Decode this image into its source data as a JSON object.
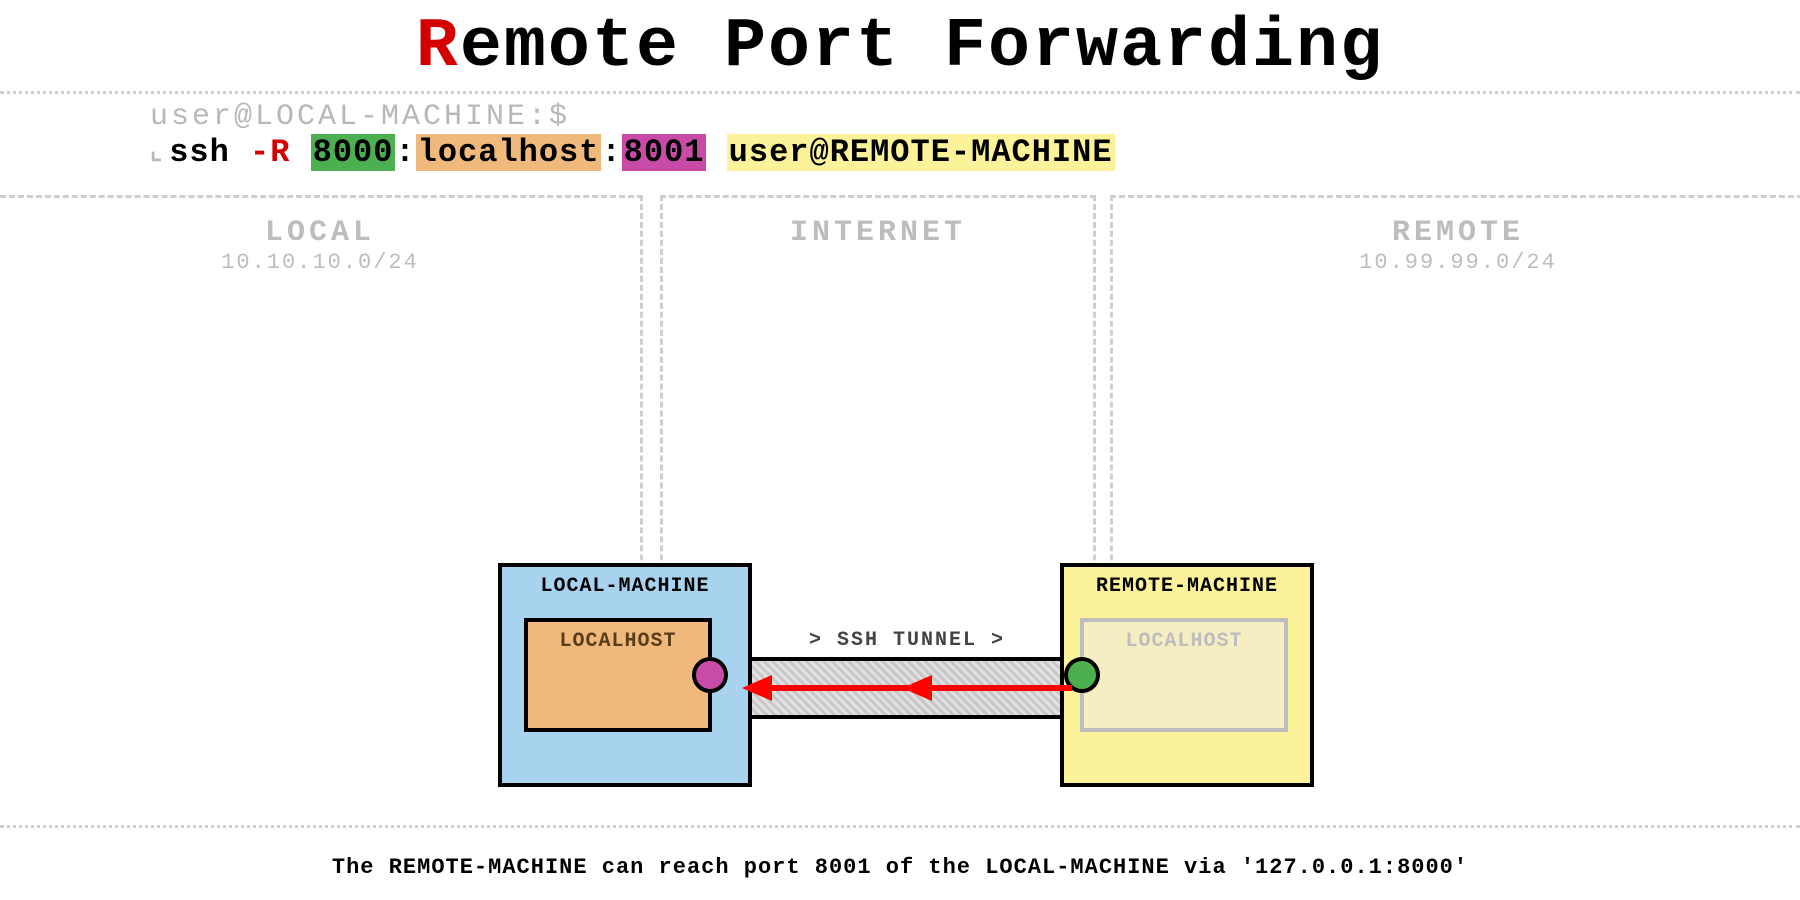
{
  "title_first": "R",
  "title_rest": "emote Port Forwarding",
  "prompt": "user@LOCAL-MACHINE:$",
  "cmd": {
    "ssh": "ssh ",
    "flag": "-R",
    "port_remote": "8000",
    "sep1": ":",
    "host": "localhost",
    "sep2": ":",
    "port_local": "8001",
    "target": "user@REMOTE-MACHINE"
  },
  "zones": {
    "local": {
      "title": "LOCAL",
      "subnet": "10.10.10.0/24"
    },
    "middle": {
      "title": "INTERNET"
    },
    "remote": {
      "title": "REMOTE",
      "subnet": "10.99.99.0/24"
    }
  },
  "boxes": {
    "local": {
      "name": "LOCAL-MACHINE",
      "inner": "LOCALHOST"
    },
    "remote": {
      "name": "REMOTE-MACHINE",
      "inner": "LOCALHOST"
    }
  },
  "tunnel_label": "> SSH TUNNEL >",
  "caption": "The REMOTE-MACHINE can reach port 8001 of the LOCAL-MACHINE via '127.0.0.1:8000'"
}
